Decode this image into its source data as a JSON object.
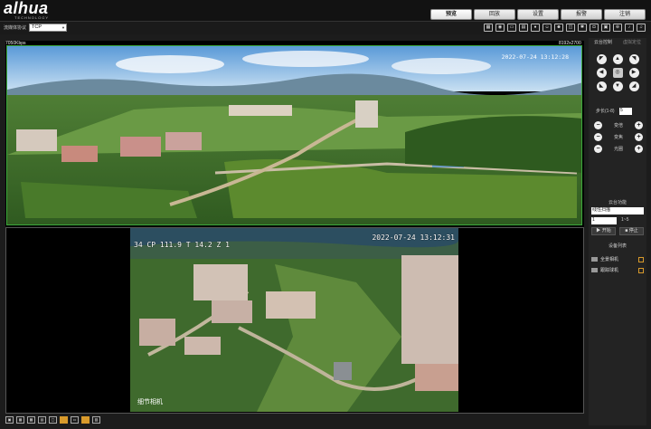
{
  "brand": {
    "logo": "alhua",
    "tagline": "TECHNOLOGY"
  },
  "nav": {
    "tabs": [
      "预览",
      "回放",
      "设置",
      "报警",
      "注销"
    ],
    "active": 0
  },
  "subbar": {
    "protocol_label": "流媒体协议",
    "protocol_value": "TCP",
    "icons": [
      "layout-icon",
      "ptz-icon",
      "track-icon",
      "rule-icon",
      "mic-icon",
      "person-icon",
      "person2-icon",
      "split-icon",
      "gear-icon",
      "snapshot-icon",
      "record-icon",
      "zoom-icon",
      "volume-icon",
      "talk-icon"
    ]
  },
  "video": {
    "pano_info": "7050Kbps",
    "pano_resolution": "8192x2700",
    "pano_time": "2022-07-24 13:12:28",
    "detail_osd": "34 CP 111.9 T 14.2 Z 1",
    "detail_time": "2022-07-24 13:12:31",
    "detail_label": "细节相机"
  },
  "bottom_icons": [
    "win1",
    "win4",
    "win9",
    "win16",
    "full",
    "orange1",
    "normal",
    "orange2",
    "exit"
  ],
  "panel": {
    "tabs": [
      "云台控制",
      "虚拟定位"
    ],
    "speed_label": "步长(1-8)",
    "speed_value": "5",
    "zoom_rows": [
      {
        "label": "变倍"
      },
      {
        "label": "变焦"
      },
      {
        "label": "光圈"
      }
    ],
    "function_title": "云台功能",
    "function_value": "线性扫描",
    "function_number": "1",
    "function_range": "1~5",
    "start_label": "开始",
    "stop_label": "停止",
    "device_title": "设备列表",
    "devices": [
      "全景相机",
      "跟踪球机"
    ]
  }
}
